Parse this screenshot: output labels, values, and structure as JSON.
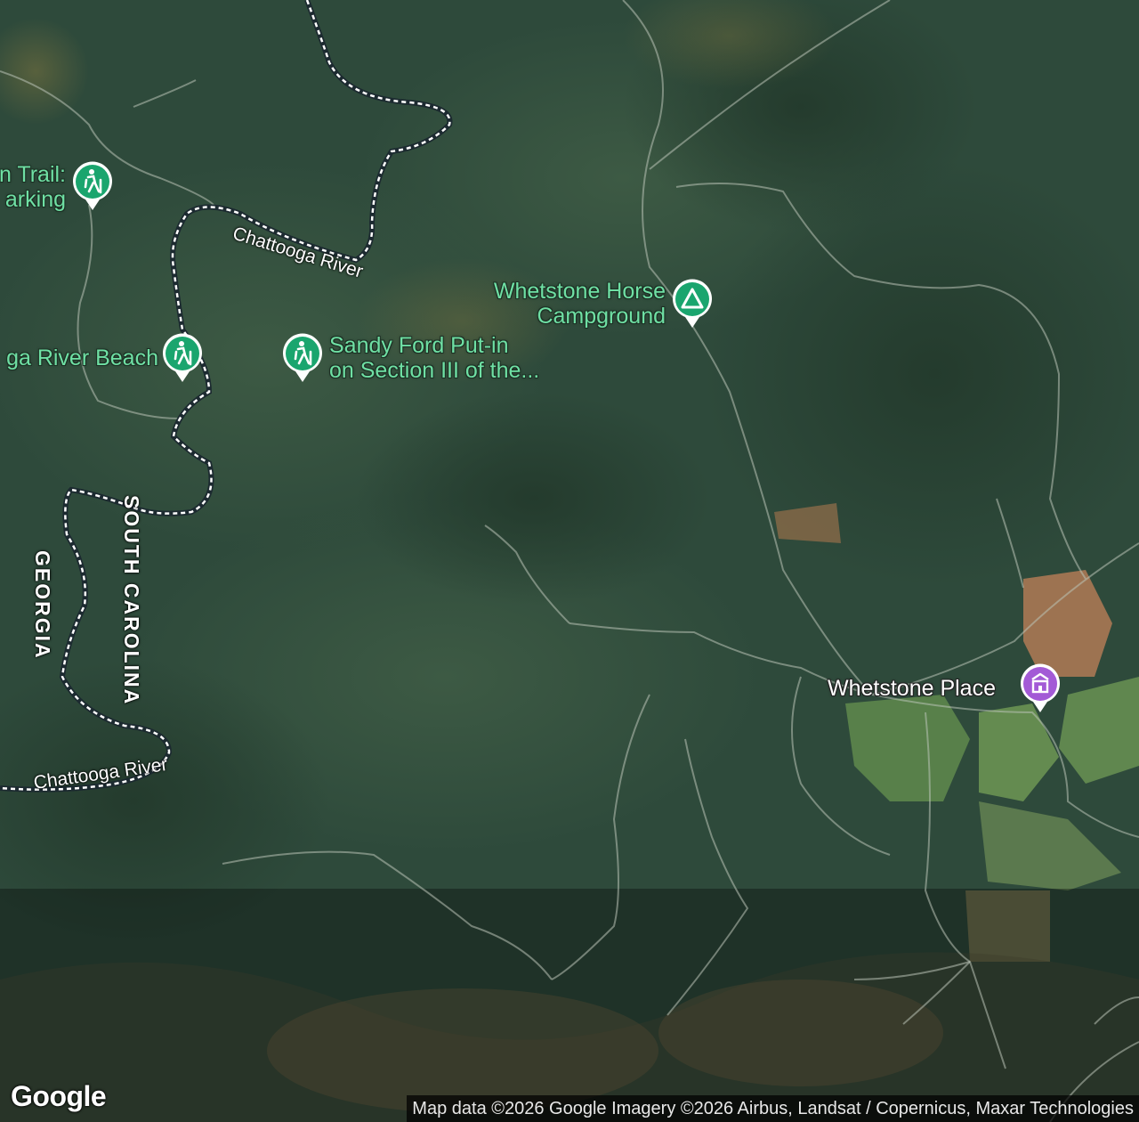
{
  "map": {
    "type": "satellite",
    "colors": {
      "forest": "#2f4a3a",
      "river": "#1c2a30",
      "recreation_green": "#1aa56e",
      "historic_purple": "#a35ad6"
    },
    "rivers": [
      {
        "name": "Chattooga River"
      },
      {
        "name": "Chattooga River"
      }
    ],
    "states": [
      {
        "name": "GEORGIA"
      },
      {
        "name": "SOUTH CAROLINA"
      }
    ],
    "pois": [
      {
        "line1": "n Trail:",
        "line2": "arking",
        "icon": "hiker-icon"
      },
      {
        "line1": "ga River Beach",
        "icon": "hiker-icon"
      },
      {
        "line1": "Sandy Ford Put-in",
        "line2": "on Section III of the...",
        "icon": "hiker-icon"
      },
      {
        "line1": "Whetstone Horse",
        "line2": "Campground",
        "icon": "campground-icon"
      }
    ],
    "places": [
      {
        "name": "Whetstone Place",
        "icon": "historic-building-icon"
      }
    ]
  },
  "branding": {
    "logo": "Google",
    "attribution": "Map data ©2026 Google Imagery ©2026 Airbus, Landsat / Copernicus, Maxar Technologies"
  }
}
